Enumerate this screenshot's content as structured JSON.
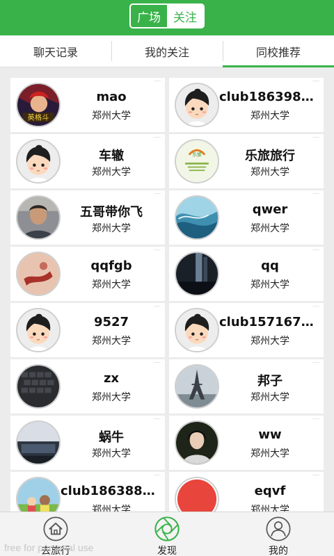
{
  "header": {
    "segment": [
      "广场",
      "关注"
    ],
    "active_segment": 1,
    "accent_color": "#39b24a"
  },
  "tabs": [
    "聊天记录",
    "我的关注",
    "同校推荐"
  ],
  "active_tab": 2,
  "users": [
    {
      "name": "mao",
      "school": "郑州大学",
      "avatar": "game-character-avatar"
    },
    {
      "name": "club1863989...",
      "school": "郑州大学",
      "avatar": "default-cartoon-avatar"
    },
    {
      "name": "车辙",
      "school": "郑州大学",
      "avatar": "default-cartoon-avatar"
    },
    {
      "name": "乐旅旅行",
      "school": "郑州大学",
      "avatar": "logo-avatar"
    },
    {
      "name": "五哥带你飞",
      "school": "郑州大学",
      "avatar": "portrait-photo-avatar"
    },
    {
      "name": "qwer",
      "school": "郑州大学",
      "avatar": "ocean-wave-avatar"
    },
    {
      "name": "qqfgb",
      "school": "郑州大学",
      "avatar": "skin-photo-avatar"
    },
    {
      "name": "qq",
      "school": "郑州大学",
      "avatar": "dark-photo-avatar"
    },
    {
      "name": "9527",
      "school": "郑州大学",
      "avatar": "default-cartoon-avatar"
    },
    {
      "name": "club1571672...",
      "school": "郑州大学",
      "avatar": "default-cartoon-avatar"
    },
    {
      "name": "zx",
      "school": "郑州大学",
      "avatar": "keyboard-photo-avatar"
    },
    {
      "name": "邦子",
      "school": "郑州大学",
      "avatar": "eiffel-tower-avatar"
    },
    {
      "name": "蜗牛",
      "school": "郑州大学",
      "avatar": "landscape-photo-avatar"
    },
    {
      "name": "ww",
      "school": "郑州大学",
      "avatar": "girl-photo-avatar"
    },
    {
      "name": "club1863883...",
      "school": "郑州大学",
      "avatar": "anime-scene-avatar"
    },
    {
      "name": "eqvf",
      "school": "郑州大学",
      "avatar": "red-circle-avatar"
    }
  ],
  "bottom_nav": [
    {
      "label": "去旅行",
      "icon": "home-icon"
    },
    {
      "label": "发现",
      "icon": "aperture-icon"
    },
    {
      "label": "我的",
      "icon": "user-icon"
    }
  ],
  "active_nav": 1,
  "watermark": "free for personal use"
}
